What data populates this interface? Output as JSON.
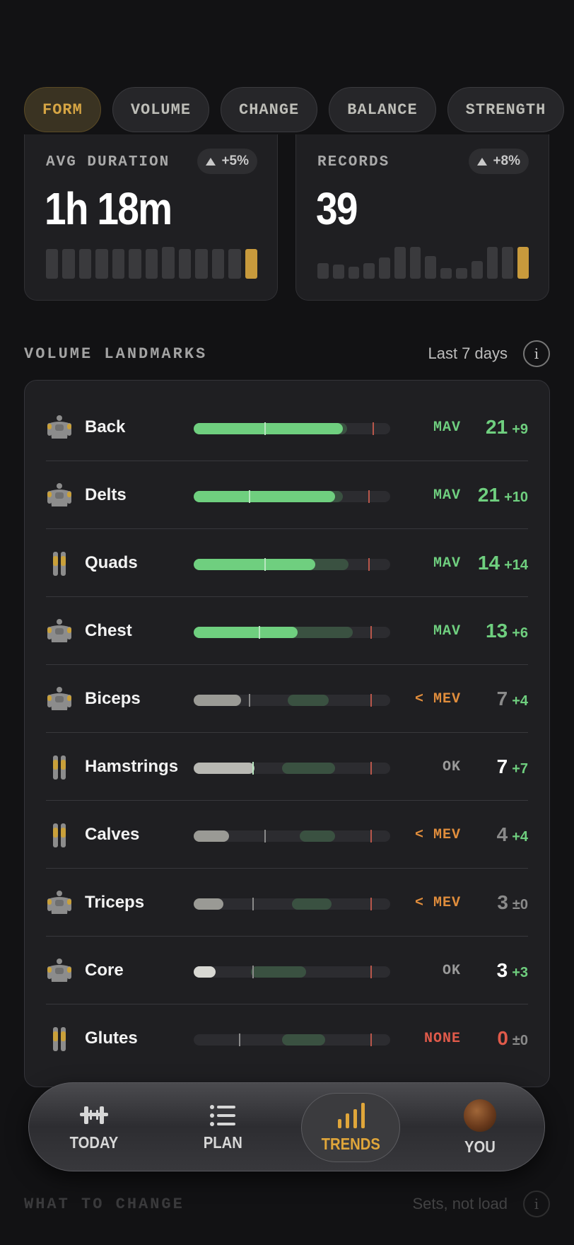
{
  "filter_chips": [
    {
      "label": "FORM",
      "active": true
    },
    {
      "label": "VOLUME",
      "active": false
    },
    {
      "label": "CHANGE",
      "active": false
    },
    {
      "label": "BALANCE",
      "active": false
    },
    {
      "label": "STRENGTH",
      "active": false
    }
  ],
  "stats": {
    "avg_duration": {
      "label": "AVG DURATION",
      "change": "+5%",
      "value": "1h 18m",
      "spark": [
        0.85,
        0.85,
        0.85,
        0.85,
        0.85,
        0.85,
        0.85,
        0.9,
        0.85,
        0.85,
        0.85,
        0.85,
        0.85
      ]
    },
    "records": {
      "label": "RECORDS",
      "change": "+8%",
      "value": "39",
      "spark": [
        0.45,
        0.4,
        0.35,
        0.45,
        0.6,
        0.9,
        0.9,
        0.65,
        0.3,
        0.3,
        0.5,
        0.9,
        0.9,
        0.9
      ]
    }
  },
  "landmarks_section": {
    "title": "VOLUME LANDMARKS",
    "period": "Last 7 days",
    "info_glyph": "i",
    "rows": [
      {
        "muscle": "Back",
        "fill": 0.76,
        "band_start": 0.34,
        "band_end": 0.78,
        "mev": 0.36,
        "mrv": 0.91,
        "status": "MAV",
        "status_color": "#6fcf7f",
        "sets": "21",
        "delta": "+9",
        "sets_color": "#6fcf7f",
        "fill_color": "#6fcf7f"
      },
      {
        "muscle": "Delts",
        "fill": 0.72,
        "band_start": 0.28,
        "band_end": 0.76,
        "mev": 0.28,
        "mrv": 0.89,
        "status": "MAV",
        "status_color": "#6fcf7f",
        "sets": "21",
        "delta": "+10",
        "sets_color": "#6fcf7f",
        "fill_color": "#6fcf7f"
      },
      {
        "muscle": "Quads",
        "fill": 0.62,
        "band_start": 0.35,
        "band_end": 0.79,
        "mev": 0.36,
        "mrv": 0.89,
        "status": "MAV",
        "status_color": "#6fcf7f",
        "sets": "14",
        "delta": "+14",
        "sets_color": "#6fcf7f",
        "fill_color": "#6fcf7f"
      },
      {
        "muscle": "Chest",
        "fill": 0.53,
        "band_start": 0.33,
        "band_end": 0.81,
        "mev": 0.33,
        "mrv": 0.9,
        "status": "MAV",
        "status_color": "#6fcf7f",
        "sets": "13",
        "delta": "+6",
        "sets_color": "#6fcf7f",
        "fill_color": "#6fcf7f"
      },
      {
        "muscle": "Biceps",
        "fill": 0.24,
        "band_start": 0.48,
        "band_end": 0.69,
        "mev": 0.28,
        "mrv": 0.9,
        "status": "< MEV",
        "status_color": "#e08d3c",
        "sets": "7",
        "delta": "+4",
        "sets_color": "#8a8a8a",
        "fill_color": "#9a9a95"
      },
      {
        "muscle": "Hamstrings",
        "fill": 0.31,
        "band_start": 0.45,
        "band_end": 0.72,
        "mev": 0.3,
        "mrv": 0.9,
        "status": "OK",
        "status_color": "#9a9a9a",
        "sets": "7",
        "delta": "+7",
        "sets_color": "#ffffff",
        "fill_color": "#b8b8b3"
      },
      {
        "muscle": "Calves",
        "fill": 0.18,
        "band_start": 0.54,
        "band_end": 0.72,
        "mev": 0.36,
        "mrv": 0.9,
        "status": "< MEV",
        "status_color": "#e08d3c",
        "sets": "4",
        "delta": "+4",
        "sets_color": "#8a8a8a",
        "fill_color": "#9a9a95"
      },
      {
        "muscle": "Triceps",
        "fill": 0.15,
        "band_start": 0.5,
        "band_end": 0.7,
        "mev": 0.3,
        "mrv": 0.9,
        "status": "< MEV",
        "status_color": "#e08d3c",
        "sets": "3",
        "delta": "±0",
        "sets_color": "#8a8a8a",
        "fill_color": "#9a9a95"
      },
      {
        "muscle": "Core",
        "fill": 0.11,
        "band_start": 0.29,
        "band_end": 0.57,
        "mev": 0.3,
        "mrv": 0.9,
        "status": "OK",
        "status_color": "#9a9a9a",
        "sets": "3",
        "delta": "+3",
        "sets_color": "#ffffff",
        "fill_color": "#d8d8d3"
      },
      {
        "muscle": "Glutes",
        "fill": 0.0,
        "band_start": 0.45,
        "band_end": 0.67,
        "mev": 0.23,
        "mrv": 0.9,
        "status": "NONE",
        "status_color": "#e05a4a",
        "sets": "0",
        "delta": "±0",
        "sets_color": "#e05a4a",
        "fill_color": "#d8d8d3"
      }
    ]
  },
  "bottom_nav": {
    "items": [
      {
        "label": "TODAY",
        "icon": "dumbbell-icon",
        "active": false
      },
      {
        "label": "PLAN",
        "icon": "list-icon",
        "active": false
      },
      {
        "label": "TRENDS",
        "icon": "bar-chart-icon",
        "active": true
      },
      {
        "label": "YOU",
        "icon": "avatar-icon",
        "active": false
      }
    ]
  },
  "next_section": {
    "title": "WHAT TO CHANGE",
    "subtitle": "Sets, not load",
    "info_glyph": "i"
  },
  "colors": {
    "accent": "#d6a544",
    "mav_green": "#6fcf7f",
    "warn_orange": "#e08d3c",
    "none_red": "#e05a4a",
    "delta_green": "#6fcf7f"
  }
}
